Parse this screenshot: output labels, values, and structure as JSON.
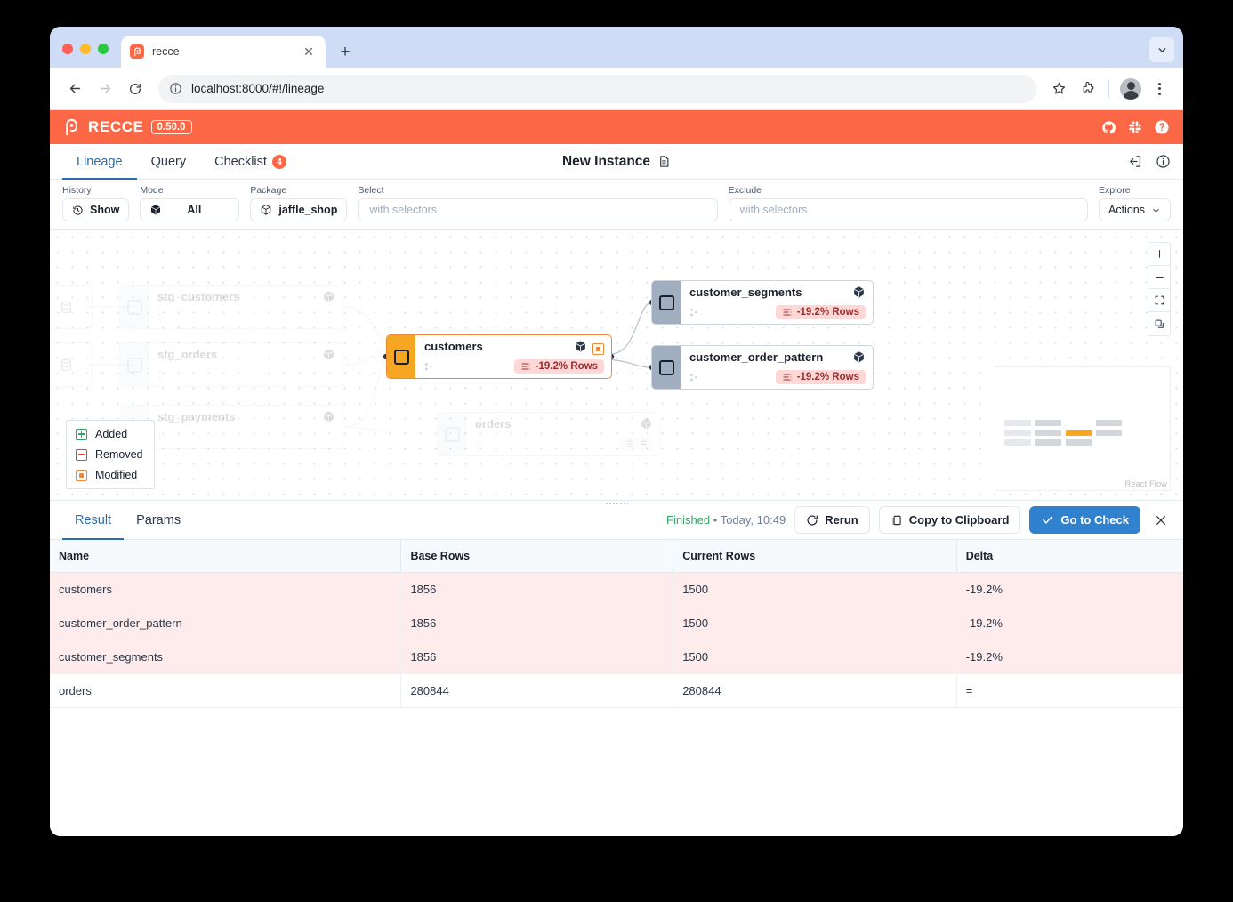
{
  "browser": {
    "tab_title": "recce",
    "favicon": "recce-icon",
    "close_tab": "close-icon",
    "new_tab": "new-tab-icon",
    "tab_list_chevron": "chevron-down-icon",
    "back": "back-arrow-icon",
    "forward": "forward-arrow-icon",
    "reload": "reload-icon",
    "site_info": "info-circle-icon",
    "url": "localhost:8000/#!/lineage",
    "bookmark": "star-icon",
    "extensions": "puzzle-icon",
    "profile": "avatar",
    "menu": "kebab-menu-icon"
  },
  "app": {
    "brand": "RECCE",
    "version": "0.50.0",
    "brand_color": "#fc6846",
    "accent_color": "#2b6cb0",
    "header_icons": [
      {
        "name": "github-icon"
      },
      {
        "name": "slack-icon"
      },
      {
        "name": "help-circle-icon"
      }
    ],
    "tabs": [
      {
        "label": "Lineage",
        "active": true,
        "badge": null
      },
      {
        "label": "Query",
        "active": false,
        "badge": null
      },
      {
        "label": "Checklist",
        "active": false,
        "badge": "4"
      }
    ],
    "instance": {
      "title": "New Instance",
      "icon": "rename-document-icon"
    },
    "tabs_right_icons": [
      {
        "name": "share-export-icon"
      },
      {
        "name": "info-circle-icon"
      }
    ]
  },
  "controls": {
    "history": {
      "label": "History",
      "value": "Show",
      "icon": "history-clock-icon"
    },
    "mode": {
      "label": "Mode",
      "value": "All",
      "icon": "package-cube-icon"
    },
    "package": {
      "label": "Package",
      "value": "jaffle_shop",
      "icon": "package-outline-icon"
    },
    "select": {
      "label": "Select",
      "value": "",
      "placeholder": "with selectors"
    },
    "exclude": {
      "label": "Exclude",
      "value": "",
      "placeholder": "with selectors"
    },
    "explore": {
      "label": "Explore",
      "value": "Actions",
      "icon": "chevron-down-icon"
    }
  },
  "lineage": {
    "nodes": [
      {
        "id": "src1",
        "type": "source",
        "name": "",
        "faded": true
      },
      {
        "id": "src2",
        "type": "source",
        "name": "",
        "faded": true
      },
      {
        "id": "stg_customers",
        "name": "stg_customers",
        "faded": true,
        "badge": null
      },
      {
        "id": "stg_orders",
        "name": "stg_orders",
        "faded": true,
        "badge": null
      },
      {
        "id": "stg_payments",
        "name": "stg_payments",
        "faded": true,
        "badge": null
      },
      {
        "id": "customers",
        "name": "customers",
        "faded": false,
        "highlight": true,
        "badge": "-19.2% Rows",
        "modified": true
      },
      {
        "id": "orders",
        "name": "orders",
        "faded": true,
        "badge": "="
      },
      {
        "id": "customer_segments",
        "name": "customer_segments",
        "faded": false,
        "badge": "-19.2% Rows"
      },
      {
        "id": "customer_order_pattern",
        "name": "customer_order_pattern",
        "faded": false,
        "badge": "-19.2% Rows"
      }
    ],
    "legend": {
      "items": [
        {
          "label": "Added",
          "icon": "added-icon",
          "color": "#38a169"
        },
        {
          "label": "Removed",
          "icon": "removed-icon",
          "color": "#e53e3e"
        },
        {
          "label": "Modified",
          "icon": "modified-icon",
          "color": "#ed8936"
        }
      ]
    },
    "zoom_controls": [
      {
        "name": "zoom-in-icon",
        "glyph": "+"
      },
      {
        "name": "zoom-out-icon",
        "glyph": "−"
      },
      {
        "name": "fit-view-icon",
        "glyph": ""
      },
      {
        "name": "toggle-interactivity-icon",
        "glyph": ""
      }
    ],
    "minimap_label": "React Flow"
  },
  "result": {
    "tabs": [
      {
        "label": "Result",
        "active": true
      },
      {
        "label": "Params",
        "active": false
      }
    ],
    "status": "Finished",
    "status_detail": "• Today, 10:49",
    "buttons": {
      "rerun": "Rerun",
      "copy": "Copy to Clipboard",
      "go_to_check": "Go to Check",
      "close": "close-icon"
    },
    "table": {
      "columns": [
        "Name",
        "Base Rows",
        "Current Rows",
        "Delta"
      ],
      "rows": [
        {
          "name": "customers",
          "base": "1856",
          "current": "1500",
          "delta": "-19.2%",
          "changed": true
        },
        {
          "name": "customer_order_pattern",
          "base": "1856",
          "current": "1500",
          "delta": "-19.2%",
          "changed": true
        },
        {
          "name": "customer_segments",
          "base": "1856",
          "current": "1500",
          "delta": "-19.2%",
          "changed": true
        },
        {
          "name": "orders",
          "base": "280844",
          "current": "280844",
          "delta": "=",
          "changed": false
        }
      ]
    }
  }
}
